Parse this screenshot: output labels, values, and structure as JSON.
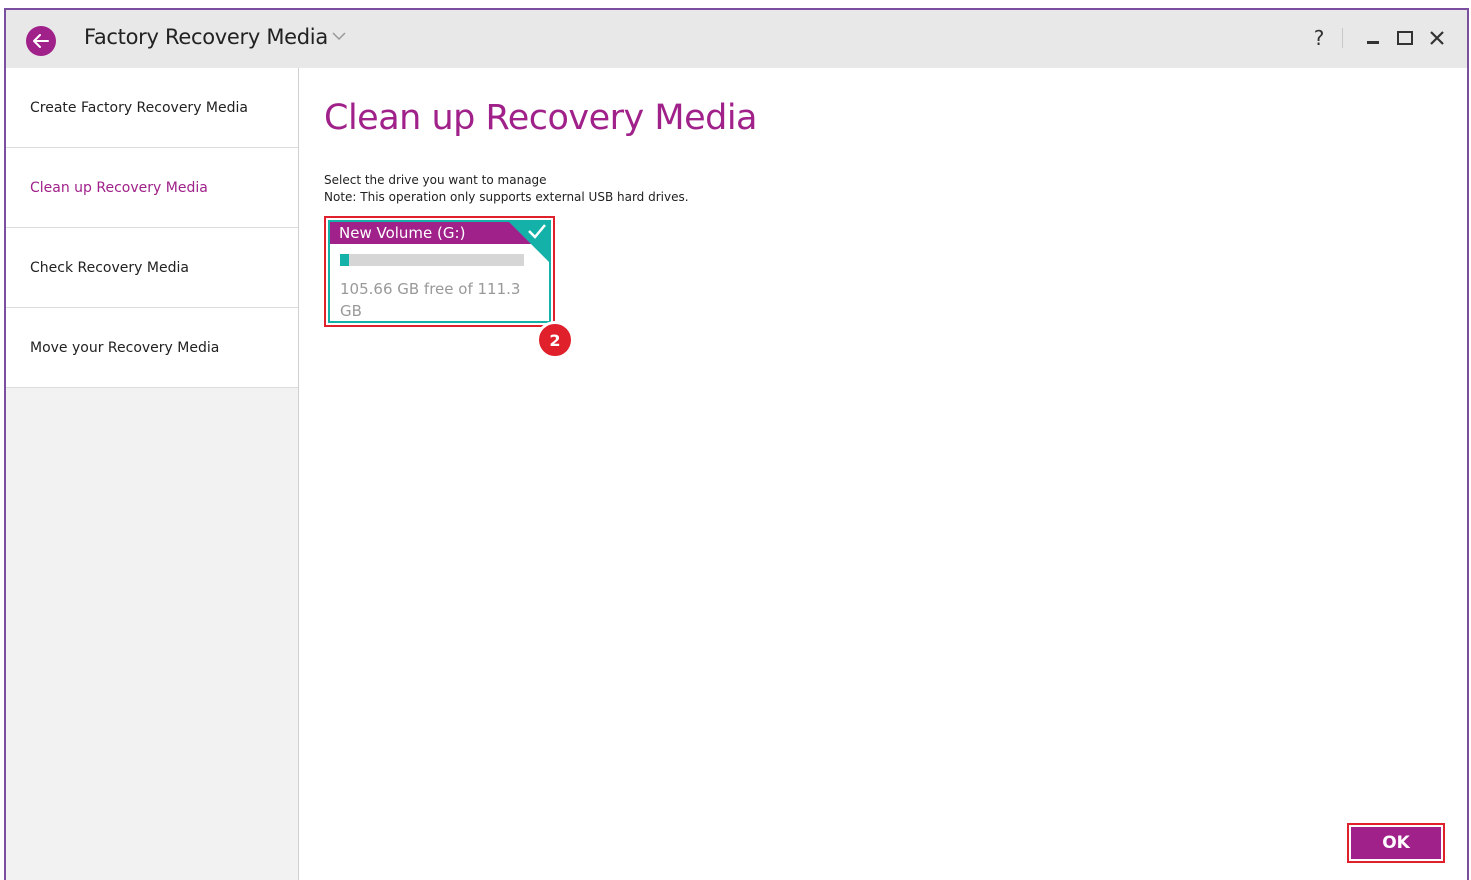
{
  "window": {
    "title": "Factory Recovery Media",
    "help_label": "?"
  },
  "sidebar": {
    "items": [
      {
        "label": "Create Factory Recovery Media"
      },
      {
        "label": "Clean up Recovery Media",
        "active": true
      },
      {
        "label": "Check Recovery Media"
      },
      {
        "label": "Move your Recovery Media"
      }
    ]
  },
  "main": {
    "title": "Clean up Recovery Media",
    "instruction": "Select the drive you want to manage",
    "note": "Note: This operation only supports external USB hard drives.",
    "drive": {
      "name": "New Volume (G:)",
      "usage_fraction": 0.05,
      "free_text": "105.66 GB free of 111.3 GB",
      "selected": true
    },
    "callout_number": "2",
    "ok_label": "OK"
  },
  "colors": {
    "accent": "#a0218a",
    "teal": "#14b1a9",
    "highlight_red": "#e0202a"
  }
}
